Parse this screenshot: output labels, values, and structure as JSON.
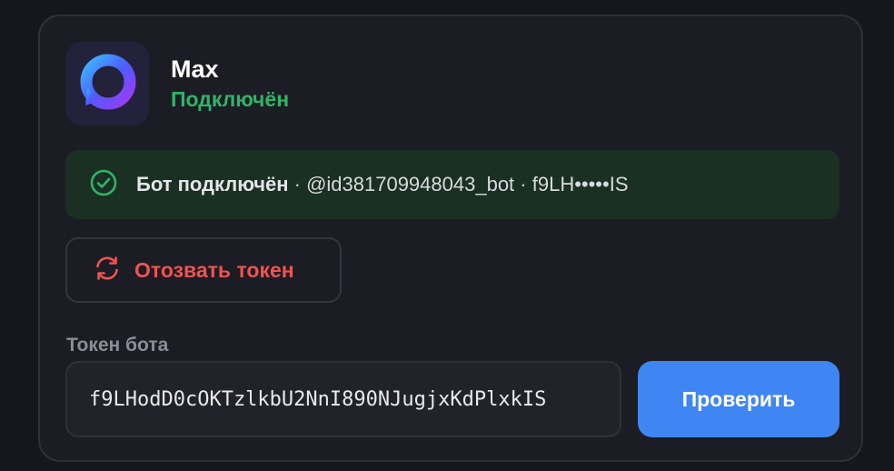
{
  "app": {
    "name": "Max",
    "status": "Подключён",
    "logo_icon": "max-logo-icon"
  },
  "banner": {
    "icon": "check-circle-icon",
    "strong": "Бот подключён",
    "separator": " · ",
    "username": "@id381709948043_bot",
    "masked_token": "f9LH•••••IS"
  },
  "revoke": {
    "icon": "refresh-icon",
    "label": "Отозвать токен"
  },
  "token": {
    "label": "Токен бота",
    "value": "f9LHodD0cOKTzlkbU2NnI890NJugjxKdPlxkIS"
  },
  "check": {
    "label": "Проверить"
  },
  "colors": {
    "accent": "#3f86f3",
    "success": "#2fb469",
    "danger": "#ef5350"
  }
}
